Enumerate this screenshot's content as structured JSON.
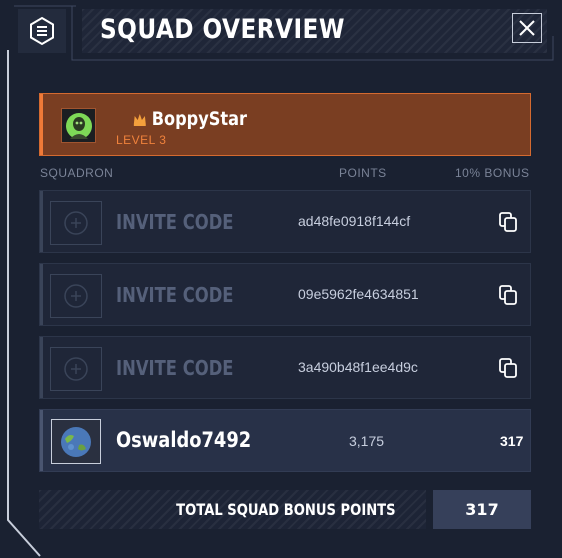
{
  "header": {
    "title": "SQUAD OVERVIEW",
    "menu_icon": "hamburger-menu-icon",
    "close_icon": "close-icon"
  },
  "leader": {
    "name": "BoppyStar",
    "level": "LEVEL 3",
    "badge_icon": "crown-icon"
  },
  "columns": {
    "squadron": "SQUADRON",
    "points": "POINTS",
    "bonus": "10% BONUS"
  },
  "invites": [
    {
      "label": "INVITE CODE",
      "code": "ad48fe0918f144cf"
    },
    {
      "label": "INVITE CODE",
      "code": "09e5962fe4634851"
    },
    {
      "label": "INVITE CODE",
      "code": "3a490b48f1ee4d9c"
    }
  ],
  "member": {
    "name": "Oswaldo7492",
    "points": "3,175",
    "bonus": "317"
  },
  "total": {
    "label": "TOTAL SQUAD BONUS POINTS",
    "value": "317"
  },
  "colors": {
    "panel": "#1a2131",
    "accent": "#f07a38",
    "leader_bg": "#7a3e22"
  }
}
